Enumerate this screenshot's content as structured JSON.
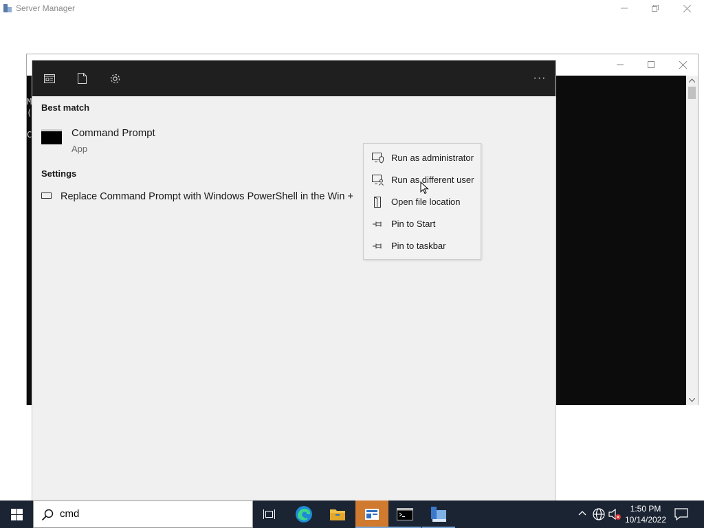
{
  "server_manager": {
    "title": "Server Manager"
  },
  "console_window": {
    "left_text": "M\n(\n\nC"
  },
  "search_panel": {
    "header_icons": [
      "apps-view-icon",
      "documents-icon",
      "settings-gear-icon"
    ],
    "more_label": "···",
    "best_match_heading": "Best match",
    "best_match": {
      "name": "Command Prompt",
      "type": "App"
    },
    "settings_heading": "Settings",
    "settings_result": "Replace Command Prompt with Windows PowerShell in the Win +"
  },
  "context_menu": {
    "items": [
      {
        "label": "Run as administrator",
        "icon": "shield-icon"
      },
      {
        "label": "Run as different user",
        "icon": "user-icon"
      },
      {
        "label": "Open file location",
        "icon": "folder-icon"
      },
      {
        "label": "Pin to Start",
        "icon": "pin-icon"
      },
      {
        "label": "Pin to taskbar",
        "icon": "pin-icon"
      }
    ]
  },
  "taskbar": {
    "search_value": "cmd",
    "apps": [
      "task-view",
      "edge",
      "file-explorer",
      "server-manager",
      "command-prompt",
      "server-manager-tool"
    ],
    "clock": {
      "time": "1:50 PM",
      "date": "10/14/2022"
    }
  },
  "colors": {
    "taskbar": "#1b2433",
    "panel_header": "#1f1f1f",
    "panel_body": "#f0f0f0",
    "active_app": "#cf7a2f"
  }
}
